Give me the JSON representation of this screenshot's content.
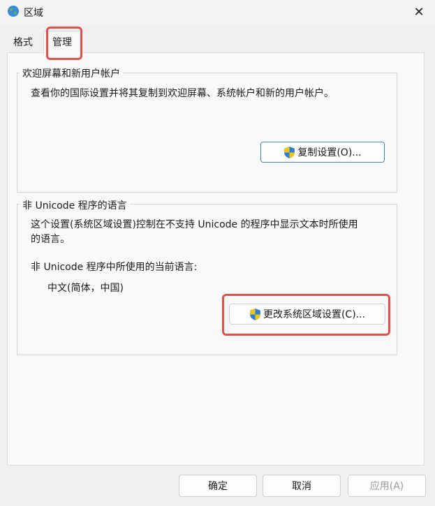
{
  "window": {
    "title": "区域"
  },
  "tabs": [
    {
      "label": "格式"
    },
    {
      "label": "管理"
    }
  ],
  "welcome_group": {
    "title": "欢迎屏幕和新用户帐户",
    "description": "查看你的国际设置并将其复制到欢迎屏幕、系统帐户和新的用户帐户。",
    "copy_button": "复制设置(O)..."
  },
  "nonunicode_group": {
    "title": "非 Unicode 程序的语言",
    "description_line1": "这个设置(系统区域设置)控制在不支持 Unicode 的程序中显示文本时所使用",
    "description_line2": "的语言。",
    "current_label": "非 Unicode 程序中所使用的当前语言:",
    "current_value": "中文(简体，中国)",
    "change_button": "更改系统区域设置(C)..."
  },
  "footer": {
    "ok": "确定",
    "cancel": "取消",
    "apply": "应用(A)"
  },
  "colors": {
    "highlight": "#d9534f",
    "accent_border": "#4a7fb0"
  }
}
